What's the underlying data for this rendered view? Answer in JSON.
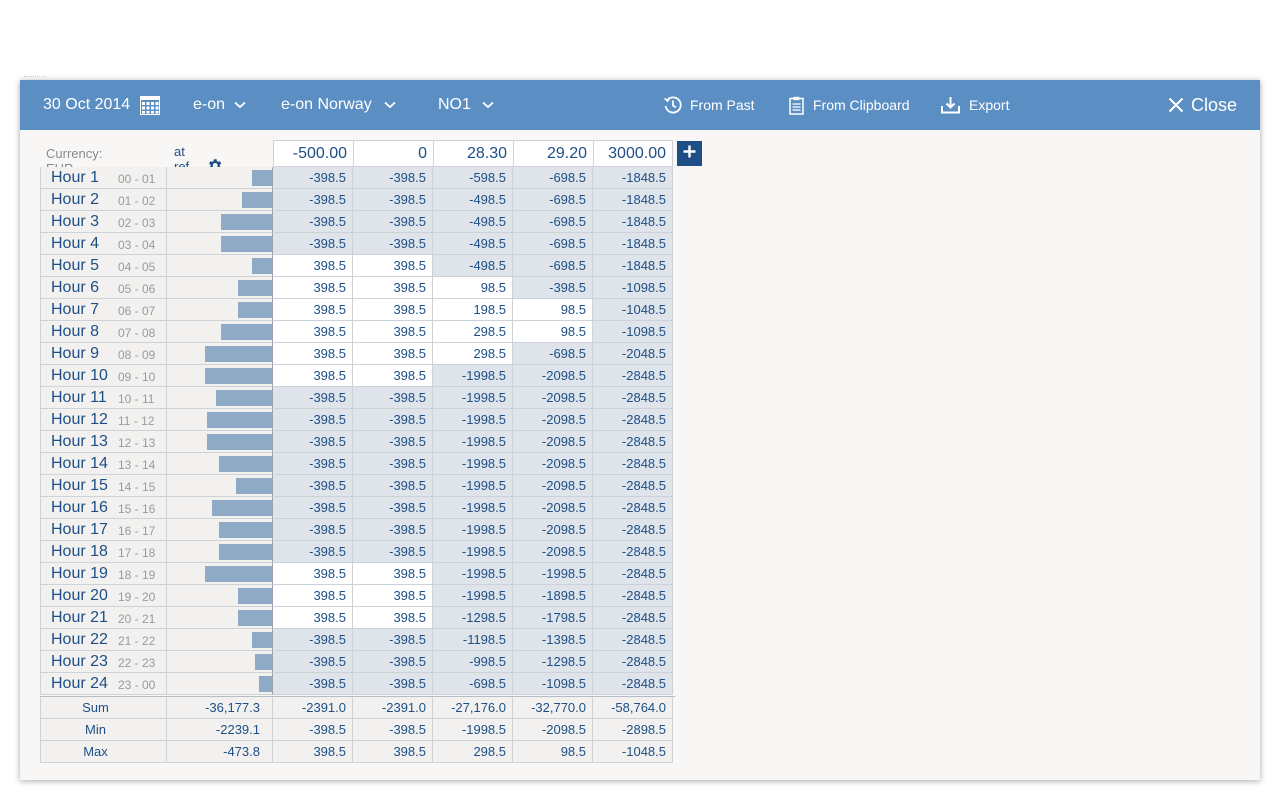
{
  "toolbar": {
    "date": "30 Oct 2014",
    "company": "e-on",
    "portfolio": "e-on Norway",
    "area": "NO1",
    "from_past": "From Past",
    "from_clipboard": "From Clipboard",
    "export": "Export",
    "close": "Close",
    "icons": [
      "calendar-icon",
      "chevron-down-icon",
      "history-icon",
      "clipboard-icon",
      "download-icon",
      "close-icon",
      "gear-icon",
      "plus-icon"
    ]
  },
  "table": {
    "currency_label": "Currency: EUR",
    "ref_price_label": "at ref. price",
    "price_columns": [
      "-500.00",
      "0",
      "28.30",
      "29.20",
      "3000.00"
    ],
    "rows": [
      {
        "name": "Hour 1",
        "range": "00 - 01",
        "bar": 0.24,
        "values": [
          "-398.5",
          "-398.5",
          "-598.5",
          "-698.5",
          "-1848.5"
        ]
      },
      {
        "name": "Hour 2",
        "range": "01 - 02",
        "bar": 0.36,
        "values": [
          "-398.5",
          "-398.5",
          "-498.5",
          "-698.5",
          "-1848.5"
        ]
      },
      {
        "name": "Hour 3",
        "range": "02 - 03",
        "bar": 0.61,
        "values": [
          "-398.5",
          "-398.5",
          "-498.5",
          "-698.5",
          "-1848.5"
        ]
      },
      {
        "name": "Hour 4",
        "range": "03 - 04",
        "bar": 0.61,
        "values": [
          "-398.5",
          "-398.5",
          "-498.5",
          "-698.5",
          "-1848.5"
        ]
      },
      {
        "name": "Hour 5",
        "range": "04 - 05",
        "bar": 0.24,
        "values": [
          "398.5",
          "398.5",
          "-498.5",
          "-698.5",
          "-1848.5"
        ]
      },
      {
        "name": "Hour 6",
        "range": "05 - 06",
        "bar": 0.41,
        "values": [
          "398.5",
          "398.5",
          "98.5",
          "-398.5",
          "-1098.5"
        ]
      },
      {
        "name": "Hour 7",
        "range": "06 - 07",
        "bar": 0.41,
        "values": [
          "398.5",
          "398.5",
          "198.5",
          "98.5",
          "-1048.5"
        ]
      },
      {
        "name": "Hour 8",
        "range": "07 - 08",
        "bar": 0.61,
        "values": [
          "398.5",
          "398.5",
          "298.5",
          "98.5",
          "-1098.5"
        ]
      },
      {
        "name": "Hour 9",
        "range": "08 - 09",
        "bar": 0.8,
        "values": [
          "398.5",
          "398.5",
          "298.5",
          "-698.5",
          "-2048.5"
        ]
      },
      {
        "name": "Hour 10",
        "range": "09 - 10",
        "bar": 0.8,
        "values": [
          "398.5",
          "398.5",
          "-1998.5",
          "-2098.5",
          "-2848.5"
        ]
      },
      {
        "name": "Hour 11",
        "range": "10 - 11",
        "bar": 0.67,
        "values": [
          "-398.5",
          "-398.5",
          "-1998.5",
          "-2098.5",
          "-2848.5"
        ]
      },
      {
        "name": "Hour 12",
        "range": "11 - 12",
        "bar": 0.77,
        "values": [
          "-398.5",
          "-398.5",
          "-1998.5",
          "-2098.5",
          "-2848.5"
        ]
      },
      {
        "name": "Hour 13",
        "range": "12 - 13",
        "bar": 0.77,
        "values": [
          "-398.5",
          "-398.5",
          "-1998.5",
          "-2098.5",
          "-2848.5"
        ]
      },
      {
        "name": "Hour 14",
        "range": "13 - 14",
        "bar": 0.63,
        "values": [
          "-398.5",
          "-398.5",
          "-1998.5",
          "-2098.5",
          "-2848.5"
        ]
      },
      {
        "name": "Hour 15",
        "range": "14 - 15",
        "bar": 0.43,
        "values": [
          "-398.5",
          "-398.5",
          "-1998.5",
          "-2098.5",
          "-2848.5"
        ]
      },
      {
        "name": "Hour 16",
        "range": "15 - 16",
        "bar": 0.71,
        "values": [
          "-398.5",
          "-398.5",
          "-1998.5",
          "-2098.5",
          "-2848.5"
        ]
      },
      {
        "name": "Hour 17",
        "range": "16 - 17",
        "bar": 0.63,
        "values": [
          "-398.5",
          "-398.5",
          "-1998.5",
          "-2098.5",
          "-2848.5"
        ]
      },
      {
        "name": "Hour 18",
        "range": "17 - 18",
        "bar": 0.63,
        "values": [
          "-398.5",
          "-398.5",
          "-1998.5",
          "-2098.5",
          "-2848.5"
        ]
      },
      {
        "name": "Hour 19",
        "range": "18 - 19",
        "bar": 0.8,
        "values": [
          "398.5",
          "398.5",
          "-1998.5",
          "-1998.5",
          "-2848.5"
        ]
      },
      {
        "name": "Hour 20",
        "range": "19 - 20",
        "bar": 0.41,
        "values": [
          "398.5",
          "398.5",
          "-1998.5",
          "-1898.5",
          "-2848.5"
        ]
      },
      {
        "name": "Hour 21",
        "range": "20 - 21",
        "bar": 0.41,
        "values": [
          "398.5",
          "398.5",
          "-1298.5",
          "-1798.5",
          "-2848.5"
        ]
      },
      {
        "name": "Hour 22",
        "range": "21 - 22",
        "bar": 0.24,
        "values": [
          "-398.5",
          "-398.5",
          "-1198.5",
          "-1398.5",
          "-2848.5"
        ]
      },
      {
        "name": "Hour 23",
        "range": "22 - 23",
        "bar": 0.2,
        "values": [
          "-398.5",
          "-398.5",
          "-998.5",
          "-1298.5",
          "-2848.5"
        ]
      },
      {
        "name": "Hour 24",
        "range": "23 - 00",
        "bar": 0.16,
        "values": [
          "-398.5",
          "-398.5",
          "-698.5",
          "-1098.5",
          "-2848.5"
        ]
      }
    ],
    "summary": [
      {
        "label": "Sum",
        "ref": "-36,177.3",
        "values": [
          "-2391.0",
          "-2391.0",
          "-27,176.0",
          "-32,770.0",
          "-58,764.0"
        ]
      },
      {
        "label": "Min",
        "ref": "-2239.1",
        "values": [
          "-398.5",
          "-398.5",
          "-1998.5",
          "-2098.5",
          "-2898.5"
        ]
      },
      {
        "label": "Max",
        "ref": "-473.8",
        "values": [
          "398.5",
          "398.5",
          "298.5",
          "98.5",
          "-1048.5"
        ]
      }
    ]
  }
}
